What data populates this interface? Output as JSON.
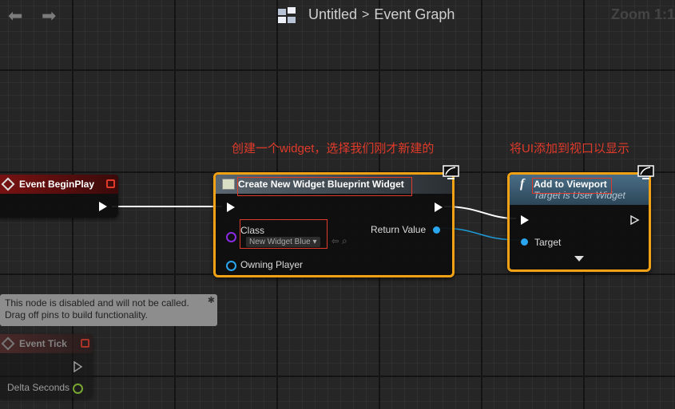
{
  "header": {
    "breadcrumb_root": "Untitled",
    "breadcrumb_separator": ">",
    "breadcrumb_current": "Event Graph",
    "zoom": "Zoom 1:1",
    "back_icon": "arrow-left-icon",
    "forward_icon": "arrow-right-icon"
  },
  "annotations": {
    "create_widget": "创建一个widget，选择我们刚才新建的",
    "add_viewport": "将UI添加到视口以显示"
  },
  "nodes": {
    "begin_play": {
      "title": "Event BeginPlay"
    },
    "create_widget": {
      "title": "Create New Widget Blueprint Widget",
      "class_label": "Class",
      "class_value": "New Widget Blue",
      "owning_player": "Owning Player",
      "return_value": "Return Value"
    },
    "add_viewport": {
      "title": "Add to Viewport",
      "subtitle": "Target is User Widget",
      "target": "Target"
    },
    "disabled_tooltip": {
      "line1": "This node is disabled and will not be called.",
      "line2": "Drag off pins to build functionality."
    },
    "event_tick": {
      "title": "Event Tick",
      "delta_seconds": "Delta Seconds"
    }
  },
  "colors": {
    "selection": "#f0a214",
    "annotation": "#e03a2a",
    "event_header": "#7a1212",
    "function_header": "#4a6e86",
    "object_pin": "#2aa6f0",
    "class_pin": "#8a2be2",
    "float_pin": "#9bdc36"
  }
}
